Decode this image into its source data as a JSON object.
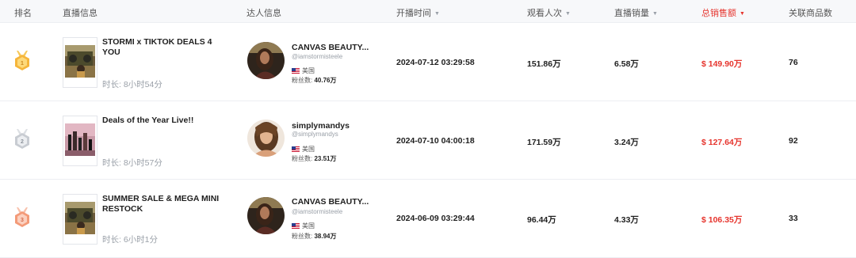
{
  "header": {
    "rank": "排名",
    "live_info": "直播信息",
    "creator_info": "达人信息",
    "start_time": "开播时间",
    "views": "观看人次",
    "live_sales": "直播销量",
    "total_sales": "总销售额",
    "linked_products": "关联商品数"
  },
  "colors": {
    "accent": "#e6352e",
    "gold": "#f5a623",
    "silver": "#c8ccd2",
    "bronze": "#f39a78"
  },
  "rows": [
    {
      "rank_medal": "gold-medal-icon",
      "title": "STORMI x TIKTOK DEALS 4 YOU",
      "duration": "时长: 8小时54分",
      "creator_name": "CANVAS BEAUTY...",
      "creator_handle": "@iamstormisteele",
      "country": "美国",
      "fans_label": "粉丝数:",
      "fans": "40.76万",
      "start_time": "2024-07-12 03:29:58",
      "views": "151.86万",
      "live_sales": "6.58万",
      "total_sales": "$ 149.90万",
      "linked_products": "76"
    },
    {
      "rank_medal": "silver-medal-icon",
      "title": "Deals of the Year Live!!",
      "duration": "时长: 8小时57分",
      "creator_name": "simplymandys",
      "creator_handle": "@simplymandys",
      "country": "美国",
      "fans_label": "粉丝数:",
      "fans": "23.51万",
      "start_time": "2024-07-10 04:00:18",
      "views": "171.59万",
      "live_sales": "3.24万",
      "total_sales": "$ 127.64万",
      "linked_products": "92"
    },
    {
      "rank_medal": "bronze-medal-icon",
      "title": "SUMMER SALE & MEGA MINI RESTOCK",
      "duration": "时长: 6小时1分",
      "creator_name": "CANVAS BEAUTY...",
      "creator_handle": "@iamstormisteele",
      "country": "美国",
      "fans_label": "粉丝数:",
      "fans": "38.94万",
      "start_time": "2024-06-09 03:29:44",
      "views": "96.44万",
      "live_sales": "4.33万",
      "total_sales": "$ 106.35万",
      "linked_products": "33"
    }
  ]
}
